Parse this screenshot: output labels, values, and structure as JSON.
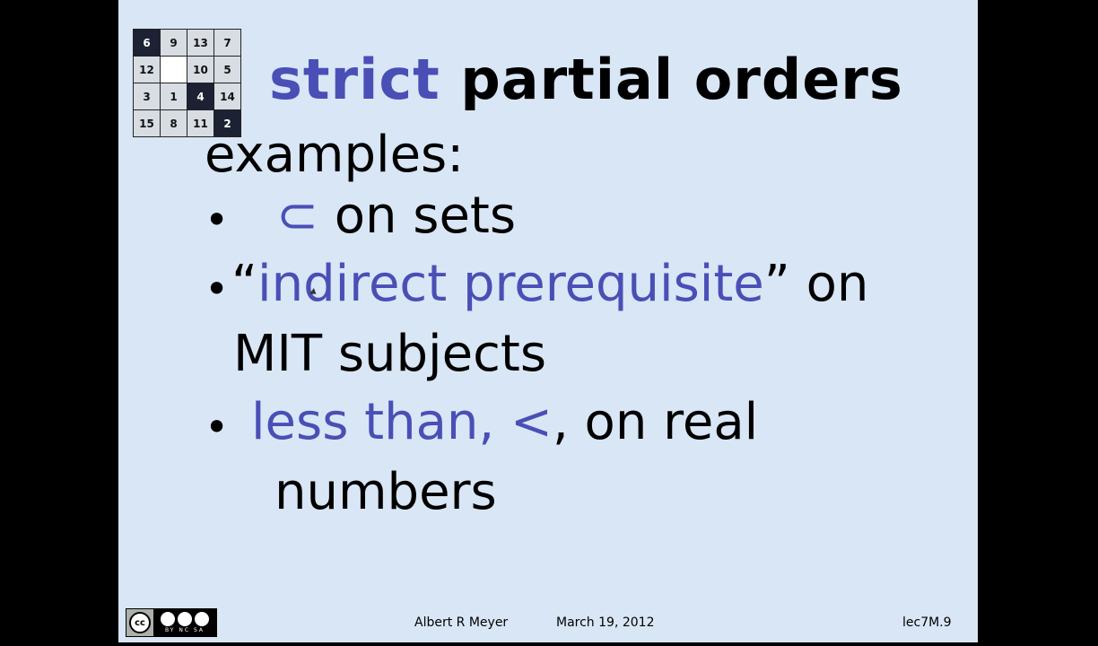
{
  "slide": {
    "title_blue": "strict",
    "title_black": " partial orders",
    "heading": "examples:",
    "bullets": [
      {
        "marker": "•",
        "parts": [
          {
            "text": "⊂",
            "color": "#4a4fb6"
          },
          {
            "text": " on sets",
            "color": "#000000"
          }
        ]
      },
      {
        "marker": "•",
        "line1": [
          {
            "text": "“",
            "color": "#000000"
          },
          {
            "text": "indirect prerequisite",
            "color": "#4a4fb6"
          },
          {
            "text": "” on",
            "color": "#000000"
          }
        ],
        "line2": "MIT subjects"
      },
      {
        "marker": "•",
        "line1": [
          {
            "text": "less than, ",
            "color": "#4a4fb6"
          },
          {
            "text": "<",
            "color": "#4a4fb6"
          },
          {
            "text": ", on real",
            "color": "#000000"
          }
        ],
        "line2": "numbers"
      }
    ]
  },
  "puzzle": {
    "tiles": [
      "6",
      "9",
      "13",
      "7",
      "12",
      "",
      "10",
      "5",
      "3",
      "1",
      "4",
      "14",
      "15",
      "8",
      "11",
      "2"
    ],
    "dark": [
      0,
      10,
      15
    ],
    "empty": [
      5
    ]
  },
  "footer": {
    "author": "Albert R Meyer",
    "date": "March 19, 2012",
    "slide_id": "lec7M.9"
  },
  "license": {
    "badge_main": "cc",
    "badge_text": "BY NC SA"
  },
  "colors": {
    "accent": "#4a4fb6",
    "slide_bg": "#d9e6f5"
  }
}
